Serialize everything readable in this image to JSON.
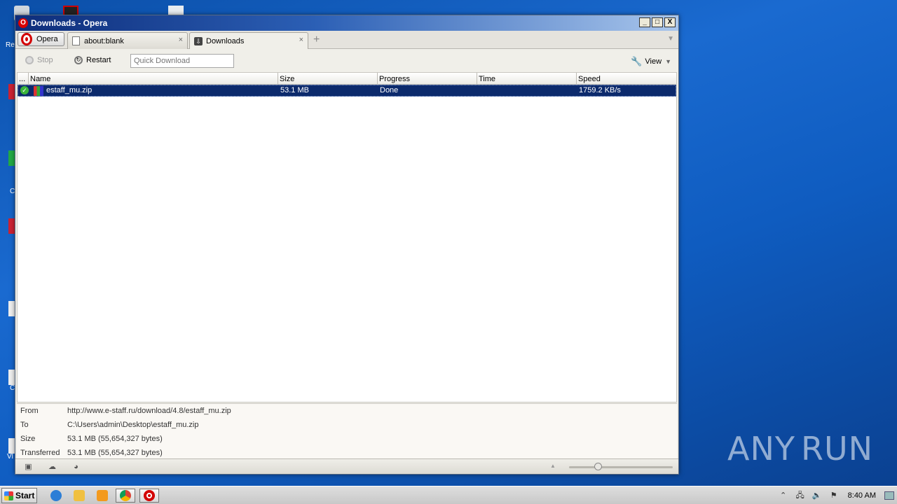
{
  "desktop": {
    "icon_labels": [
      "Re",
      "C",
      "C",
      "Vl"
    ]
  },
  "watermark": {
    "left": "ANY",
    "right": "RUN"
  },
  "window": {
    "title": "Downloads - Opera",
    "controls": {
      "minimize": "_",
      "maximize": "□",
      "close": "X"
    }
  },
  "tabs": {
    "menu_label": "Opera",
    "items": [
      {
        "label": "about:blank",
        "icon": "page-icon"
      },
      {
        "label": "Downloads",
        "icon": "downloads-icon"
      }
    ],
    "close_glyph": "×",
    "new_tab_glyph": "+"
  },
  "toolbar": {
    "stop_label": "Stop",
    "restart_label": "Restart",
    "quick_download_placeholder": "Quick Download",
    "view_label": "View"
  },
  "table": {
    "columns": [
      "...",
      "Name",
      "Size",
      "Progress",
      "Time",
      "Speed"
    ],
    "rows": [
      {
        "status": "done",
        "name": "estaff_mu.zip",
        "size": "53.1 MB",
        "progress": "Done",
        "time": "",
        "speed": "1759.2 KB/s"
      }
    ]
  },
  "details": {
    "from_label": "From",
    "from_value": "http://www.e-staff.ru/download/4.8/estaff_mu.zip",
    "to_label": "To",
    "to_value": "C:\\Users\\admin\\Desktop\\estaff_mu.zip",
    "size_label": "Size",
    "size_value": "53.1 MB (55,654,327 bytes)",
    "transferred_label": "Transferred",
    "transferred_value": "53.1 MB (55,654,327 bytes)"
  },
  "taskbar": {
    "start_label": "Start",
    "apps": [
      "internet-explorer",
      "file-explorer",
      "media-player",
      "chrome",
      "opera"
    ],
    "clock": "8:40 AM"
  },
  "colors": {
    "selection": "#0c2a6c",
    "title_gradient_start": "#0e2d7a",
    "opera_red": "#d30000"
  }
}
